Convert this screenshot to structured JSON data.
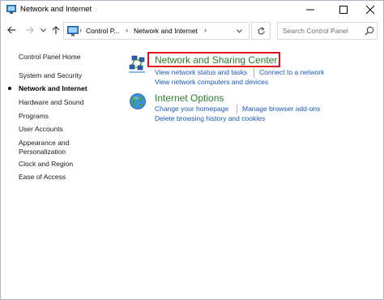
{
  "window": {
    "title": "Network and Internet",
    "icon": "control-panel-icon"
  },
  "navigation": {
    "breadcrumbs": [
      "Control P...",
      "Network and Internet"
    ],
    "search_placeholder": "Search Control Panel"
  },
  "sidebar": {
    "items": [
      {
        "label": "Control Panel Home",
        "current": false
      },
      {
        "label": "System and Security",
        "current": false
      },
      {
        "label": "Network and Internet",
        "current": true
      },
      {
        "label": "Hardware and Sound",
        "current": false
      },
      {
        "label": "Programs",
        "current": false
      },
      {
        "label": "User Accounts",
        "current": false
      },
      {
        "label": "Appearance and",
        "current": false
      },
      {
        "label": "Personalization",
        "current": false
      },
      {
        "label": "Clock and Region",
        "current": false
      },
      {
        "label": "Ease of Access",
        "current": false
      }
    ]
  },
  "categories": [
    {
      "title": "Network and Sharing Center",
      "icon": "network-sharing-icon",
      "links": [
        "View network status and tasks",
        "Connect to a network",
        "View network computers and devices"
      ]
    },
    {
      "title": "Internet Options",
      "icon": "internet-globe-icon",
      "links": [
        "Change your homepage",
        "Manage browser add-ons",
        "Delete browsing history and cookies"
      ]
    }
  ],
  "colors": {
    "heading": "#2a7d2a",
    "link": "#1a57b8",
    "highlight": "#e0101c"
  }
}
